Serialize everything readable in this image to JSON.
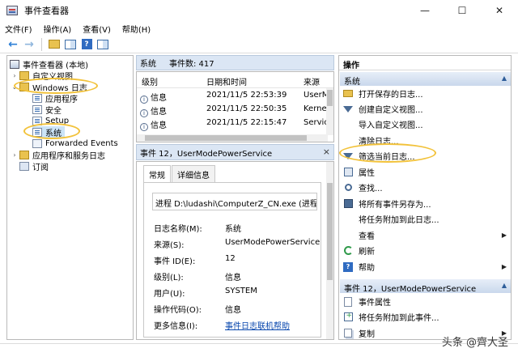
{
  "window": {
    "title": "事件查看器",
    "controls": {
      "minimize": "—",
      "maximize": "☐",
      "close": "✕"
    }
  },
  "menu": [
    "文件(F)",
    "操作(A)",
    "查看(V)",
    "帮助(H)"
  ],
  "toolbar": {
    "back_icon": "←",
    "forward_icon": "→",
    "help_glyph": "?"
  },
  "tree": {
    "items": [
      {
        "label": "事件查看器 (本地)",
        "icon": "event-viewer-icon"
      },
      {
        "label": "自定义视图",
        "icon": "folder-icon"
      },
      {
        "label": "Windows 日志",
        "icon": "folder-icon"
      },
      {
        "label": "应用程序",
        "icon": "log-icon"
      },
      {
        "label": "安全",
        "icon": "log-icon"
      },
      {
        "label": "Setup",
        "icon": "log-icon"
      },
      {
        "label": "系统",
        "icon": "log-icon"
      },
      {
        "label": "Forwarded Events",
        "icon": "forwarded-log-icon"
      },
      {
        "label": "应用程序和服务日志",
        "icon": "folder-icon"
      },
      {
        "label": "订阅",
        "icon": "subscription-icon"
      }
    ]
  },
  "events": {
    "log_name": "系统",
    "count_label": "事件数: 417",
    "columns": [
      "级别",
      "日期和时间",
      "来源"
    ],
    "rows": [
      {
        "level": "信息",
        "datetime": "2021/11/5 22:53:39",
        "source": "UserM"
      },
      {
        "level": "信息",
        "datetime": "2021/11/5 22:50:35",
        "source": "Kerne"
      },
      {
        "level": "信息",
        "datetime": "2021/11/5 22:15:47",
        "source": "Servic"
      }
    ]
  },
  "detail": {
    "header": "事件 12，UserModePowerService",
    "close_glyph": "×",
    "tabs": [
      "常规",
      "详细信息"
    ],
    "description": "进程 D:\\ludashi\\ComputerZ_CN.exe (进程 ID",
    "props": [
      {
        "label": "日志名称(M):",
        "value": "系统"
      },
      {
        "label": "来源(S):",
        "value": "UserModePowerService"
      },
      {
        "label": "事件 ID(E):",
        "value": "12"
      },
      {
        "label": "级别(L):",
        "value": "信息"
      },
      {
        "label": "用户(U):",
        "value": "SYSTEM"
      },
      {
        "label": "操作代码(O):",
        "value": "信息"
      },
      {
        "label": "更多信息(I):",
        "value": "事件日志联机帮助"
      }
    ]
  },
  "actions": {
    "title": "操作",
    "group1": "系统",
    "group1_items": [
      {
        "label": "打开保存的日志...",
        "icon": "open-folder-icon",
        "submenu": false
      },
      {
        "label": "创建自定义视图...",
        "icon": "filter-icon",
        "submenu": false
      },
      {
        "label": "导入自定义视图...",
        "icon": "",
        "submenu": false
      },
      {
        "label": "清除日志...",
        "icon": "",
        "submenu": false
      },
      {
        "label": "筛选当前日志...",
        "icon": "filter-icon",
        "submenu": false
      },
      {
        "label": "属性",
        "icon": "properties-icon",
        "submenu": false
      },
      {
        "label": "查找...",
        "icon": "search-icon",
        "submenu": false
      },
      {
        "label": "将所有事件另存为...",
        "icon": "save-icon",
        "submenu": false
      },
      {
        "label": "将任务附加到此日志...",
        "icon": "",
        "submenu": false
      },
      {
        "label": "查看",
        "icon": "",
        "submenu": true
      },
      {
        "label": "刷新",
        "icon": "refresh-icon",
        "submenu": false
      },
      {
        "label": "帮助",
        "icon": "help-icon",
        "submenu": true
      }
    ],
    "group2": "事件 12，UserModePowerService",
    "group2_items": [
      {
        "label": "事件属性",
        "icon": "event-properties-icon",
        "submenu": false
      },
      {
        "label": "将任务附加到此事件...",
        "icon": "attach-task-icon",
        "submenu": false
      },
      {
        "label": "复制",
        "icon": "copy-icon",
        "submenu": true
      }
    ]
  },
  "watermark": "头条 @齊大圣",
  "colors": {
    "highlight": "#f2c23a",
    "selection": "#cce4f7",
    "header_bg": "#dbe6f4",
    "link": "#0645ad"
  }
}
